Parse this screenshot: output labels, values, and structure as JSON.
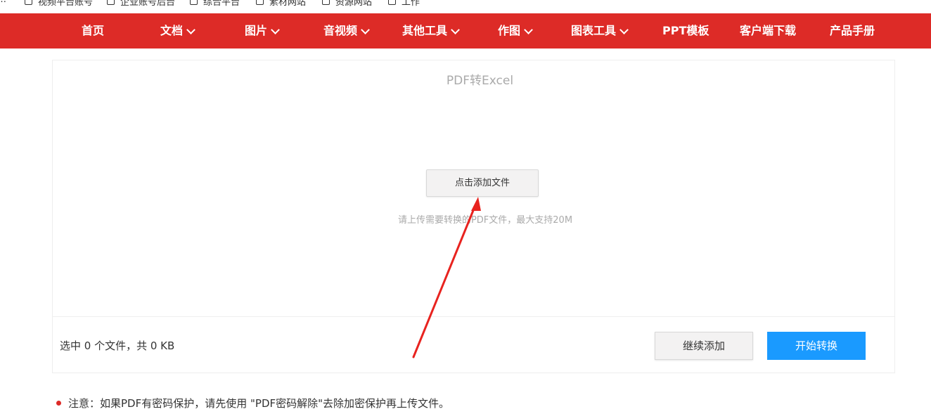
{
  "bookmarks": [
    "视频平台账号",
    "企业账号后台",
    "综合平台",
    "素材网站",
    "资源网站",
    "工作"
  ],
  "nav": {
    "items": [
      {
        "label": "首页",
        "dropdown": false
      },
      {
        "label": "文档",
        "dropdown": true
      },
      {
        "label": "图片",
        "dropdown": true
      },
      {
        "label": "音视频",
        "dropdown": true
      },
      {
        "label": "其他工具",
        "dropdown": true
      },
      {
        "label": "作图",
        "dropdown": true
      },
      {
        "label": "图表工具",
        "dropdown": true
      },
      {
        "label": "PPT模板",
        "dropdown": false
      },
      {
        "label": "客户端下载",
        "dropdown": false
      },
      {
        "label": "产品手册",
        "dropdown": false
      }
    ],
    "color": "#dd2b27"
  },
  "converter": {
    "title": "PDF转Excel",
    "add_file_label": "点击添加文件",
    "hint": "请上传需要转换的PDF文件，最大支持20M",
    "status": "选中 0 个文件，共 0 KB",
    "continue_label": "继续添加",
    "start_label": "开始转换",
    "start_color": "#1a9aff"
  },
  "note": "注意：如果PDF有密码保护，请先使用 \"PDF密码解除\"去除加密保护再上传文件。",
  "annotation": {
    "arrow_color": "#e8231f"
  }
}
